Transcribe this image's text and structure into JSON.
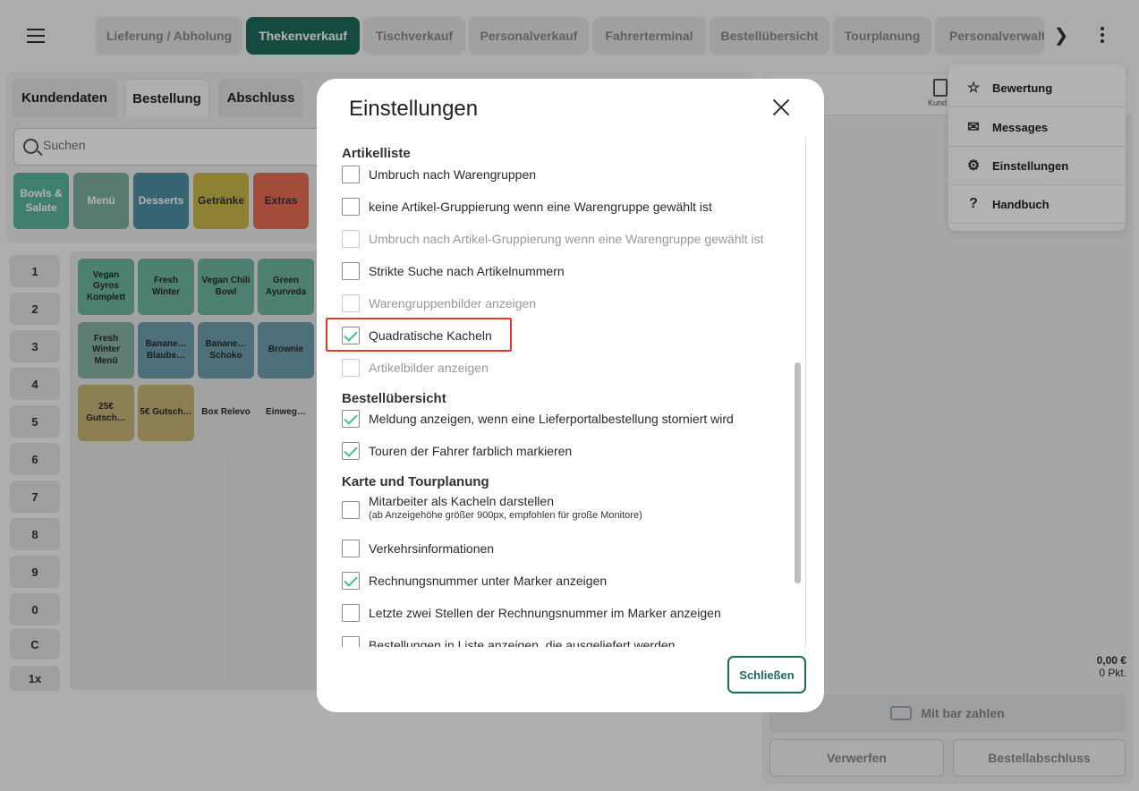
{
  "nav": {
    "tabs": [
      "Lieferung / Abholung",
      "Thekenverkauf",
      "Tischverkauf",
      "Personalverkauf",
      "Fahrerterminal",
      "Bestellübersicht",
      "Tourplanung",
      "Personalverwalte"
    ],
    "active_tab": "Thekenverkauf",
    "next": "❯"
  },
  "subtabs": [
    "Kundendaten",
    "Bestellung",
    "Abschluss"
  ],
  "search": {
    "placeholder": "Suchen"
  },
  "groups": [
    {
      "label": "Bowls & Salate",
      "color": "#5cb5a0"
    },
    {
      "label": "Menü",
      "color": "#7fb0a3"
    },
    {
      "label": "Desserts",
      "color": "#4e90a5"
    },
    {
      "label": "Getränke",
      "color": "#cdb94a"
    },
    {
      "label": "Extras",
      "color": "#e86f55"
    }
  ],
  "numpad": [
    "1",
    "2",
    "3",
    "4",
    "5",
    "6",
    "7",
    "8",
    "9",
    "0",
    "C",
    "1x"
  ],
  "items": [
    {
      "label": "Vegan Gyros Komplett",
      "color": "#6fb8a2"
    },
    {
      "label": "Fresh Winter",
      "color": "#6fb8a2"
    },
    {
      "label": "Vegan Chili Bowl",
      "color": "#6fb8a2"
    },
    {
      "label": "Green Ayurveda",
      "color": "#6fb8a2"
    },
    {
      "label": "Fresh Winter Menü",
      "color": "#87b3a5"
    },
    {
      "label": "Banane… Blaube…",
      "color": "#6f9fae"
    },
    {
      "label": "Banane… Schoko",
      "color": "#6f9fae"
    },
    {
      "label": "Brownie",
      "color": "#6f9fae"
    },
    {
      "label": "25€ Gutsch…",
      "color": "#c9b679"
    },
    {
      "label": "5€ Gutsch…",
      "color": "#c9b679"
    },
    {
      "label": "Box Relevo",
      "color": "#e9e9e9"
    },
    {
      "label": "Einweg…",
      "color": "#e9e9e9"
    }
  ],
  "right": {
    "qr_label": "Kund",
    "total": "0,00 €",
    "points": "0 Pkt.",
    "pay": "Mit bar zahlen",
    "discard": "Verwerfen",
    "finish": "Bestellabschluss"
  },
  "menu": [
    {
      "label": "Bewertung",
      "icon": "rating-icon"
    },
    {
      "label": "Messages",
      "icon": "mail-icon"
    },
    {
      "label": "Einstellungen",
      "icon": "gear-icon"
    },
    {
      "label": "Handbuch",
      "icon": "help-icon"
    }
  ],
  "modal": {
    "title": "Einstellungen",
    "close_button": "Schließen",
    "sections": [
      {
        "heading": "Artikelliste",
        "options": [
          {
            "label": "Umbruch nach Warengruppen",
            "checked": false,
            "disabled": false
          },
          {
            "label": "keine Artikel-Gruppierung wenn eine Warengruppe gewählt ist",
            "checked": false,
            "disabled": false
          },
          {
            "label": "Umbruch nach Artikel-Gruppierung wenn eine Warengruppe gewählt ist",
            "checked": false,
            "disabled": true
          },
          {
            "label": "Strikte Suche nach Artikelnummern",
            "checked": false,
            "disabled": false
          },
          {
            "label": "Warengruppenbilder anzeigen",
            "checked": false,
            "disabled": true
          },
          {
            "label": "Quadratische Kacheln",
            "checked": true,
            "disabled": false,
            "highlighted": true
          },
          {
            "label": "Artikelbilder anzeigen",
            "checked": false,
            "disabled": true
          }
        ]
      },
      {
        "heading": "Bestellübersicht",
        "options": [
          {
            "label": "Meldung anzeigen, wenn eine Lieferportalbestellung storniert wird",
            "checked": true,
            "disabled": false
          },
          {
            "label": "Touren der Fahrer farblich markieren",
            "checked": true,
            "disabled": false
          }
        ]
      },
      {
        "heading": "Karte und Tourplanung",
        "options": [
          {
            "label": "Mitarbeiter als Kacheln darstellen",
            "sub": "(ab Anzeigehöhe größer 900px, empfohlen für große Monitore)",
            "checked": false,
            "disabled": false
          },
          {
            "label": "Verkehrsinformationen",
            "checked": false,
            "disabled": false
          },
          {
            "label": "Rechnungsnummer unter Marker anzeigen",
            "checked": true,
            "disabled": false
          },
          {
            "label": "Letzte zwei Stellen der Rechnungsnummer im Marker anzeigen",
            "checked": false,
            "disabled": false
          },
          {
            "label": "Bestellungen in Liste anzeigen, die ausgeliefert werden",
            "checked": false,
            "disabled": false
          }
        ]
      }
    ]
  }
}
